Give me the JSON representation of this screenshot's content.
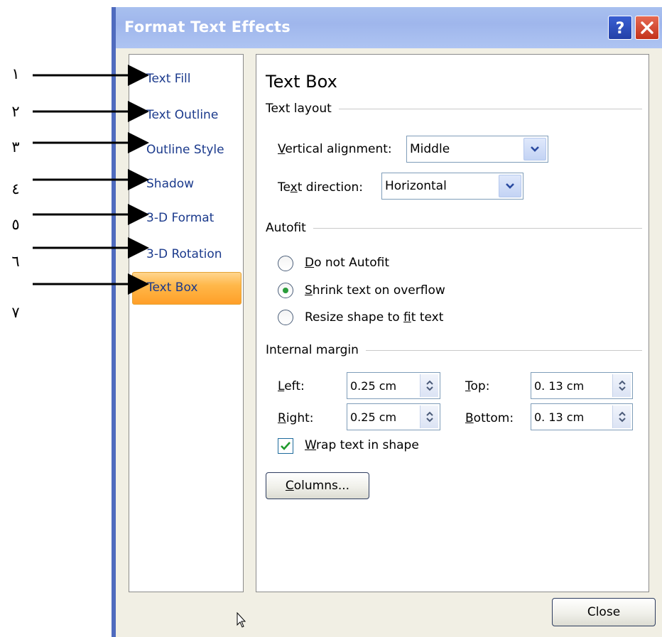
{
  "annotations": [
    "١",
    "٢",
    "٣",
    "٤",
    "٥",
    "٦",
    "٧"
  ],
  "dialog": {
    "title": "Format Text Effects",
    "help_icon": "question-mark-icon",
    "close_icon": "close-x-icon"
  },
  "nav": {
    "items": [
      "Text Fill",
      "Text Outline",
      "Outline Style",
      "Shadow",
      "3-D Format",
      "3-D Rotation",
      "Text Box"
    ],
    "selected": "Text Box"
  },
  "panel": {
    "title": "Text Box",
    "text_layout": {
      "heading": "Text layout",
      "vertical_alignment_label": "Vertical alignment:",
      "vertical_alignment_value": "Middle",
      "text_direction_label": "Text direction:",
      "text_direction_value": "Horizontal"
    },
    "autofit": {
      "heading": "Autofit",
      "options": [
        "Do not Autofit",
        "Shrink text on overflow",
        "Resize shape to fit text"
      ],
      "selected": "Shrink text on overflow"
    },
    "internal_margin": {
      "heading": "Internal margin",
      "left_label": "Left:",
      "left_value": "0.25 cm",
      "right_label": "Right:",
      "right_value": "0.25 cm",
      "top_label": "Top:",
      "top_value": "0. 13 cm",
      "bottom_label": "Bottom:",
      "bottom_value": "0. 13 cm",
      "wrap_label": "Wrap text in shape",
      "wrap_checked": true
    },
    "columns_button": "Columns..."
  },
  "footer": {
    "close_button": "Close"
  },
  "colors": {
    "titlebar": "#a8c0ef",
    "dialog_bg": "#f1efe4",
    "nav_text": "#1b3a8c",
    "selected_item": "#ffb84a"
  }
}
